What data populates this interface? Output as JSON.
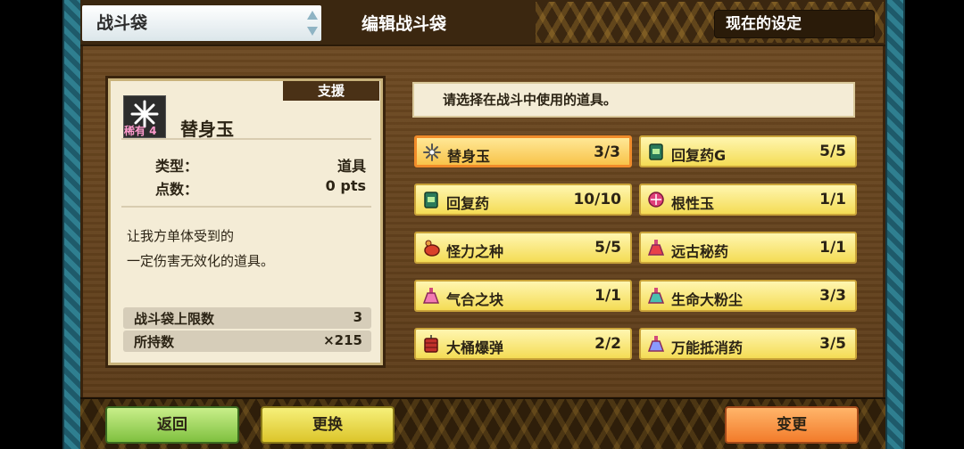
{
  "header": {
    "tab_label": "战斗袋",
    "title": "编辑战斗袋",
    "current_settings": "现在的设定"
  },
  "detail": {
    "type_tab": "支援",
    "rarity": "稀有 4",
    "name": "替身玉",
    "type_label": "类型：",
    "type_value": "道具",
    "points_label": "点数：",
    "points_value": "0 pts",
    "description_line1": "让我方单体受到的",
    "description_line2": "一定伤害无效化的道具。",
    "bag_limit_label": "战斗袋上限数",
    "bag_limit_value": "3",
    "owned_label": "所持数",
    "owned_value": "×215"
  },
  "instruction": "请选择在战斗中使用的道具。",
  "items": [
    {
      "name": "替身玉",
      "count": "3/3",
      "icon": "substitute-orb-icon",
      "selected": true
    },
    {
      "name": "回复药G",
      "count": "5/5",
      "icon": "potion-can-icon"
    },
    {
      "name": "回复药",
      "count": "10/10",
      "icon": "potion-can-icon"
    },
    {
      "name": "根性玉",
      "count": "1/1",
      "icon": "guts-orb-icon"
    },
    {
      "name": "怪力之种",
      "count": "5/5",
      "icon": "seed-pouch-icon"
    },
    {
      "name": "远古秘药",
      "count": "1/1",
      "icon": "flask-icon"
    },
    {
      "name": "气合之块",
      "count": "1/1",
      "icon": "flask-icon"
    },
    {
      "name": "生命大粉尘",
      "count": "3/3",
      "icon": "flask-icon"
    },
    {
      "name": "大桶爆弹",
      "count": "2/2",
      "icon": "barrel-bomb-icon"
    },
    {
      "name": "万能抵消药",
      "count": "3/5",
      "icon": "flask-icon"
    }
  ],
  "footer": {
    "back": "返回",
    "swap": "更换",
    "change": "变更"
  },
  "colors": {
    "board": "#6e4a22",
    "slot_fill": "#f4dc55",
    "slot_selected_border": "#f08b2a",
    "back_button": "#7fc03f",
    "swap_button": "#dcc52a",
    "change_button": "#f27b2a"
  }
}
